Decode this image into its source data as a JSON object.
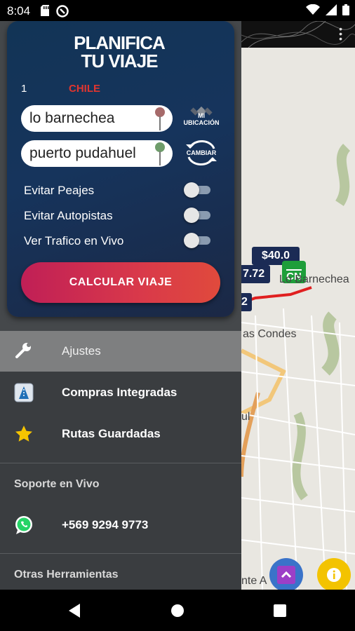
{
  "status_bar": {
    "time": "8:04"
  },
  "planner": {
    "logo_line1": "PLANIFICA",
    "logo_line2": "TU VIAJE",
    "number": "1",
    "country": "CHILE",
    "origin_value": "lo barnechea",
    "destination_value": "puerto pudahuel",
    "my_location_line1": "MI",
    "my_location_line2": "UBICACIÓN",
    "swap_label": "CAMBIAR",
    "toggles": [
      {
        "label": "Evitar Peajes",
        "on": false
      },
      {
        "label": "Evitar Autopistas",
        "on": false
      },
      {
        "label": "Ver Trafico en Vivo",
        "on": false
      }
    ],
    "calculate_label": "CALCULAR VIAJE"
  },
  "menu": {
    "items": [
      {
        "label": "Ajustes",
        "icon": "wrench-icon",
        "active": true
      },
      {
        "label": "Compras Integradas",
        "icon": "store-icon"
      },
      {
        "label": "Rutas Guardadas",
        "icon": "star-icon"
      }
    ],
    "support_section": "Soporte en Vivo",
    "whatsapp_number": "+569 9294 9773",
    "tools_section": "Otras Herramientas"
  },
  "map": {
    "price_main": "$40.0",
    "price_partial": "7.72",
    "price_partial2": "2",
    "label_barnechea": "Lo Barnechea",
    "label_condes": "as Condes",
    "label_ul": "ul",
    "label_bottom": "nte A",
    "tag_label": "CN"
  },
  "colors": {
    "accent_red": "#e0352f",
    "card_blue": "#16345c",
    "calc_gradient_start": "#c01f56",
    "calc_gradient_end": "#e04a3c"
  }
}
